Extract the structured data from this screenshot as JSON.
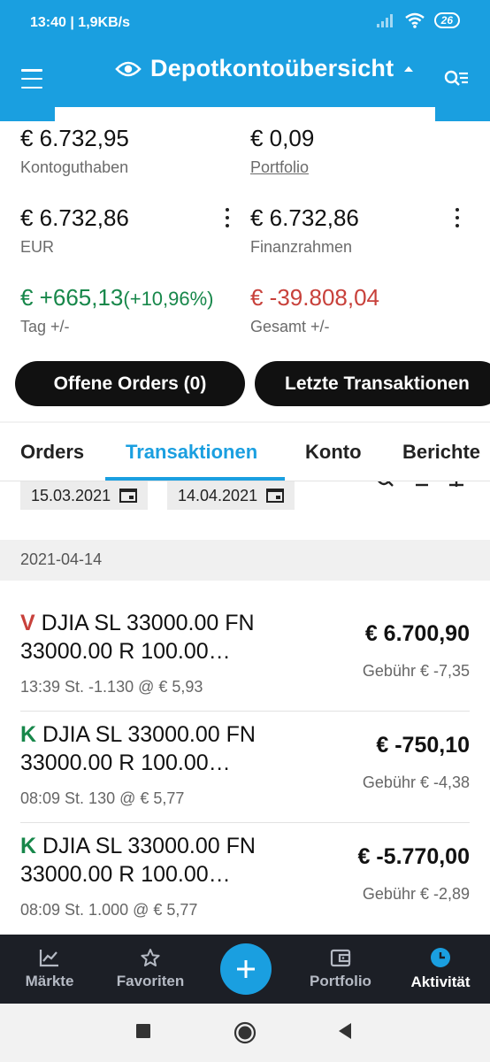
{
  "status_bar": {
    "time": "13:40 | 1,9KB/s",
    "battery": "26",
    "icons": [
      "signal-icon",
      "wifi-icon",
      "battery-icon"
    ]
  },
  "app_bar": {
    "title": "Depotkontoübersicht",
    "icons": [
      "menu-icon",
      "eye-icon",
      "caret-up-icon",
      "filter-list-icon"
    ]
  },
  "summary": {
    "kontoguthaben": {
      "value": "€ 6.732,95",
      "label": "Kontoguthaben"
    },
    "portfolio": {
      "value": "€ 0,09",
      "label": "Portfolio"
    },
    "eur": {
      "value": "€ 6.732,86",
      "label": "EUR"
    },
    "finanzrahmen": {
      "value": "€ 6.732,86",
      "label": "Finanzrahmen"
    },
    "tag": {
      "value": "€ +665,13",
      "pct": "(+10,96%)",
      "label": "Tag +/-"
    },
    "gesamt": {
      "value": "€ -39.808,04",
      "label": "Gesamt +/-"
    }
  },
  "pills": {
    "offene_orders": "Offene Orders (0)",
    "letzte_transaktionen": "Letzte Transaktionen"
  },
  "tabs": [
    {
      "label": "Orders",
      "active": false
    },
    {
      "label": "Transaktionen",
      "active": true
    },
    {
      "label": "Konto",
      "active": false
    },
    {
      "label": "Berichte",
      "active": false
    }
  ],
  "date_filter": {
    "from": "15.03.2021",
    "to": "14.04.2021"
  },
  "group_date": "2021-04-14",
  "transactions": [
    {
      "type": "V",
      "title": "DJIA SL 33000.00 FN 33000.00 R 100.00…",
      "detail": "13:39 St. -1.130 @ € 5,93",
      "amount": "€ 6.700,90",
      "fee": "Gebühr € -7,35"
    },
    {
      "type": "K",
      "title": "DJIA SL 33000.00 FN 33000.00 R 100.00…",
      "detail": "08:09 St. 130 @ € 5,77",
      "amount": "€ -750,10",
      "fee": "Gebühr € -4,38"
    },
    {
      "type": "K",
      "title": "DJIA SL 33000.00 FN 33000.00 R 100.00…",
      "detail": "08:09 St. 1.000 @ € 5,77",
      "amount": "€ -5.770,00",
      "fee": "Gebühr € -2,89"
    }
  ],
  "bottom_nav": [
    {
      "label": "Märkte",
      "icon": "chart-icon",
      "active": false
    },
    {
      "label": "Favoriten",
      "icon": "star-icon",
      "active": false
    },
    {
      "label": "Portfolio",
      "icon": "wallet-icon",
      "active": false
    },
    {
      "label": "Aktivität",
      "icon": "clock-icon",
      "active": true
    }
  ],
  "fab_icon": "plus-icon",
  "colors": {
    "primary": "#1a9fe0",
    "positive": "#17874a",
    "negative": "#c8413b",
    "nav_bg": "#1c1f26"
  }
}
